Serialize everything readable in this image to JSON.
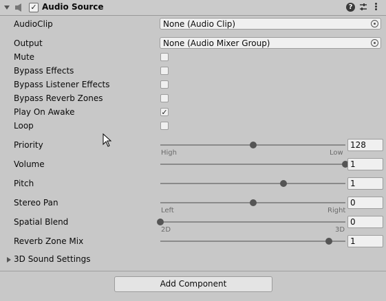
{
  "header": {
    "title": "Audio Source",
    "enabled": true,
    "help_icon": "help-icon",
    "preset_icon": "preset-icon",
    "menu_icon": "kebab-menu-icon"
  },
  "fields": {
    "audio_clip": {
      "label": "AudioClip",
      "value": "None (Audio Clip)"
    },
    "output": {
      "label": "Output",
      "value": "None (Audio Mixer Group)"
    }
  },
  "toggles": [
    {
      "label": "Mute",
      "checked": false
    },
    {
      "label": "Bypass Effects",
      "checked": false
    },
    {
      "label": "Bypass Listener Effects",
      "checked": false
    },
    {
      "label": "Bypass Reverb Zones",
      "checked": false
    },
    {
      "label": "Play On Awake",
      "checked": true,
      "mark": "✓"
    },
    {
      "label": "Loop",
      "checked": false
    }
  ],
  "sliders": {
    "priority": {
      "label": "Priority",
      "value": "128",
      "min": 0,
      "max": 256,
      "left_caption": "High",
      "right_caption": "Low"
    },
    "volume": {
      "label": "Volume",
      "value": "1",
      "min": 0,
      "max": 1
    },
    "pitch": {
      "label": "Pitch",
      "value": "1",
      "min": -3,
      "max": 3
    },
    "stereo_pan": {
      "label": "Stereo Pan",
      "value": "0",
      "min": -1,
      "max": 1,
      "left_caption": "Left",
      "right_caption": "Right"
    },
    "spatial_blend": {
      "label": "Spatial Blend",
      "value": "0",
      "min": 0,
      "max": 1,
      "left_caption": "2D",
      "right_caption": "3D"
    },
    "reverb_zone_mix": {
      "label": "Reverb Zone Mix",
      "value": "1",
      "min": 0,
      "max": 1.1
    }
  },
  "foldout": {
    "label": "3D Sound Settings",
    "expanded": false
  },
  "add_component": {
    "label": "Add Component"
  }
}
